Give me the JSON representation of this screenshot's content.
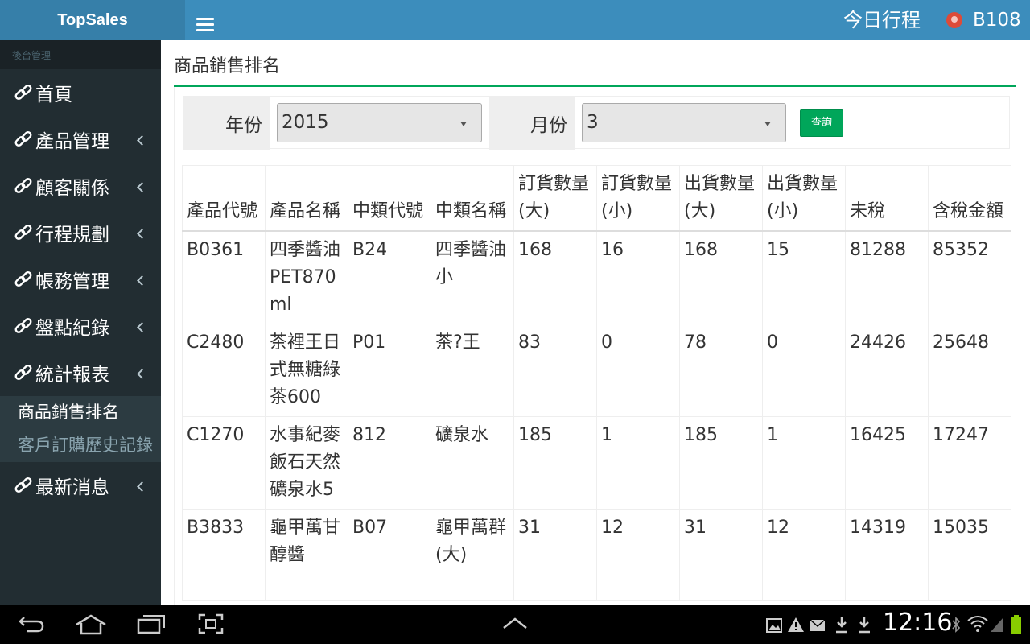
{
  "header": {
    "brand": "TopSales",
    "schedule_link": "今日行程",
    "user": "B108"
  },
  "sidebar": {
    "section_title": "後台管理",
    "items": [
      {
        "label": "首頁",
        "has_submenu": false
      },
      {
        "label": "產品管理",
        "has_submenu": true
      },
      {
        "label": "顧客關係",
        "has_submenu": true
      },
      {
        "label": "行程規劃",
        "has_submenu": true
      },
      {
        "label": "帳務管理",
        "has_submenu": true
      },
      {
        "label": "盤點紀錄",
        "has_submenu": true
      },
      {
        "label": "統計報表",
        "has_submenu": true,
        "expanded": true
      },
      {
        "label": "最新消息",
        "has_submenu": true
      }
    ],
    "submenu": [
      {
        "label": "商品銷售排名",
        "active": true
      },
      {
        "label": "客戶訂購歷史記錄",
        "active": false
      }
    ]
  },
  "page": {
    "title": "商品銷售排名"
  },
  "filter": {
    "year_label": "年份",
    "year_value": "2015",
    "month_label": "月份",
    "month_value": "3",
    "query_button": "查詢"
  },
  "table": {
    "columns": [
      "產品代號",
      "產品名稱",
      "中類代號",
      "中類名稱",
      "訂貨數量(大)",
      "訂貨數量(小)",
      "出貨數量(大)",
      "出貨數量(小)",
      "未稅",
      "含稅金額"
    ],
    "rows": [
      [
        "B0361",
        "四季醬油PET870ml",
        "B24",
        "四季醬油小",
        "168",
        "16",
        "168",
        "15",
        "81288",
        "85352"
      ],
      [
        "C2480",
        "茶裡王日式無糖綠茶600",
        "P01",
        "茶?王",
        "83",
        "0",
        "78",
        "0",
        "24426",
        "25648"
      ],
      [
        "C1270",
        "水事紀麥飯石天然礦泉水5",
        "812",
        "礦泉水",
        "185",
        "1",
        "185",
        "1",
        "16425",
        "17247"
      ],
      [
        "B3833",
        "龜甲萬甘醇醬",
        "B07",
        "龜甲萬群(大)",
        "31",
        "12",
        "31",
        "12",
        "14319",
        "15035"
      ]
    ]
  },
  "system_bar": {
    "time": "12:16"
  },
  "colors": {
    "header": "#3c8dbc",
    "logo_bg": "#367fa9",
    "sidebar": "#222d32",
    "accent_green": "#00a65a"
  }
}
